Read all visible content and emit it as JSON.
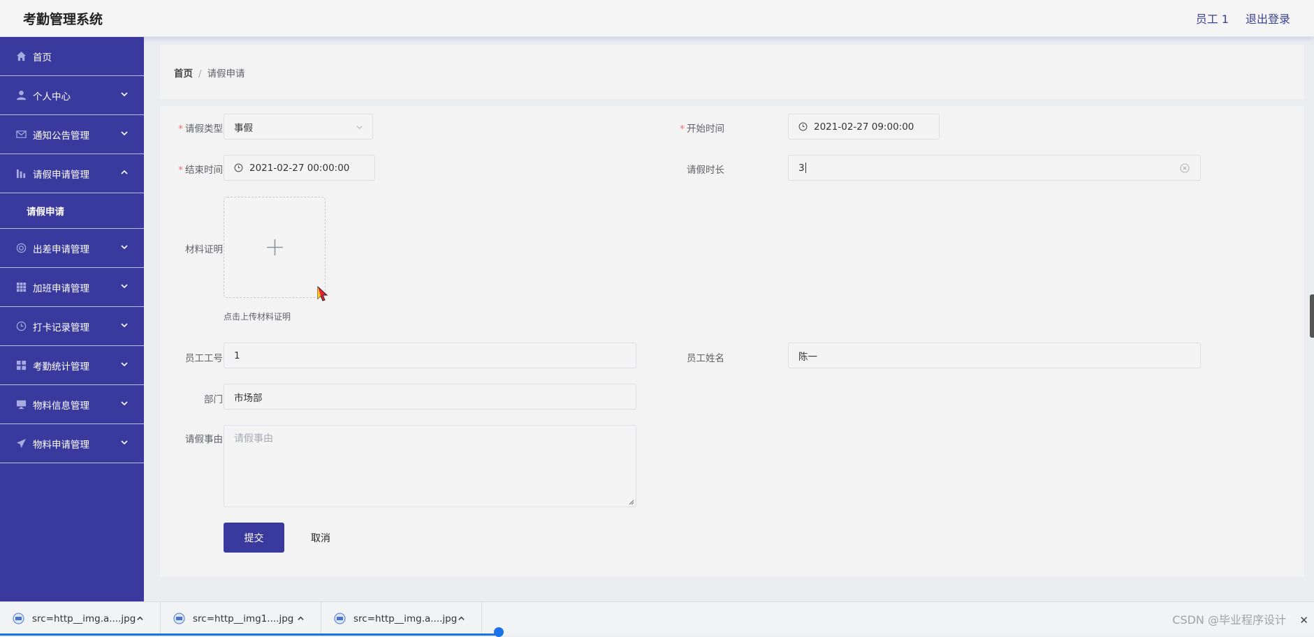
{
  "header": {
    "app_title": "考勤管理系统",
    "user_label": "员工 1",
    "logout_label": "退出登录"
  },
  "sidebar": {
    "items": [
      {
        "label": "首页",
        "icon": "home-icon"
      },
      {
        "label": "个人中心",
        "icon": "user-icon"
      },
      {
        "label": "通知公告管理",
        "icon": "mail-icon"
      },
      {
        "label": "请假申请管理",
        "icon": "chart-icon",
        "expanded": true
      },
      {
        "label": "出差申请管理",
        "icon": "globe-icon"
      },
      {
        "label": "加班申请管理",
        "icon": "grid-icon"
      },
      {
        "label": "打卡记录管理",
        "icon": "clock-icon"
      },
      {
        "label": "考勤统计管理",
        "icon": "apps-icon"
      },
      {
        "label": "物料信息管理",
        "icon": "monitor-icon"
      },
      {
        "label": "物料申请管理",
        "icon": "send-icon"
      }
    ],
    "sub_items": [
      {
        "label": "请假申请"
      }
    ]
  },
  "breadcrumb": {
    "home": "首页",
    "separator": "/",
    "current": "请假申请"
  },
  "form": {
    "leave_type": {
      "label": "请假类型",
      "value": "事假"
    },
    "start_time": {
      "label": "开始时间",
      "value": "2021-02-27 09:00:00"
    },
    "end_time": {
      "label": "结束时间",
      "value": "2021-02-27 00:00:00"
    },
    "duration": {
      "label": "请假时长",
      "value": "3"
    },
    "material": {
      "label": "材料证明",
      "tip": "点击上传材料证明"
    },
    "employee_id": {
      "label": "员工工号",
      "value": "1"
    },
    "employee_name": {
      "label": "员工姓名",
      "value": "陈一"
    },
    "department": {
      "label": "部门",
      "value": "市场部"
    },
    "reason": {
      "label": "请假事由",
      "placeholder": "请假事由"
    },
    "submit_label": "提交",
    "cancel_label": "取消",
    "required_mark": "*"
  },
  "downloads": {
    "items": [
      {
        "name": "src=http__img.a....jpg"
      },
      {
        "name": "src=http__img1....jpg"
      },
      {
        "name": "src=http__img.a....jpg"
      }
    ],
    "watermark": "CSDN @毕业程序设计"
  },
  "colors": {
    "primary": "#3a3a9e",
    "required": "#f56c6c",
    "download_progress": "#1a73e8"
  }
}
